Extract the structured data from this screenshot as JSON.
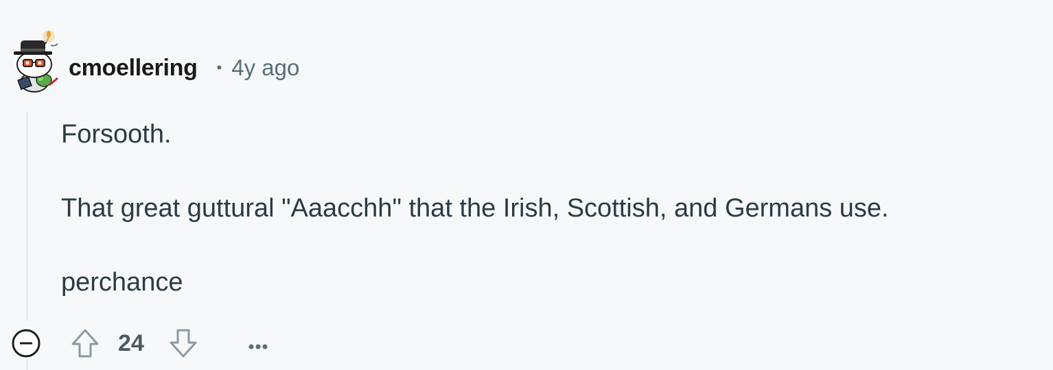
{
  "comment": {
    "author": "cmoellering",
    "separator": "•",
    "time_ago": "4y ago",
    "body": [
      "Forsooth.",
      "That great guttural \"Aaacchh\" that the Irish, Scottish, and Germans use.",
      "perchance"
    ],
    "score": "24"
  },
  "icons": {
    "avatar": "snoo-avatar",
    "collapse": "collapse-minus-icon",
    "upvote": "upvote-arrow-icon",
    "downvote": "downvote-arrow-icon",
    "more": "more-options-icon"
  },
  "colors": {
    "background": "#f7f8fa",
    "author": "#1a1a1b",
    "meta": "#576f76",
    "body_text": "#2a3c42",
    "thread_line": "#e5ebee",
    "icon": "#576f76"
  }
}
